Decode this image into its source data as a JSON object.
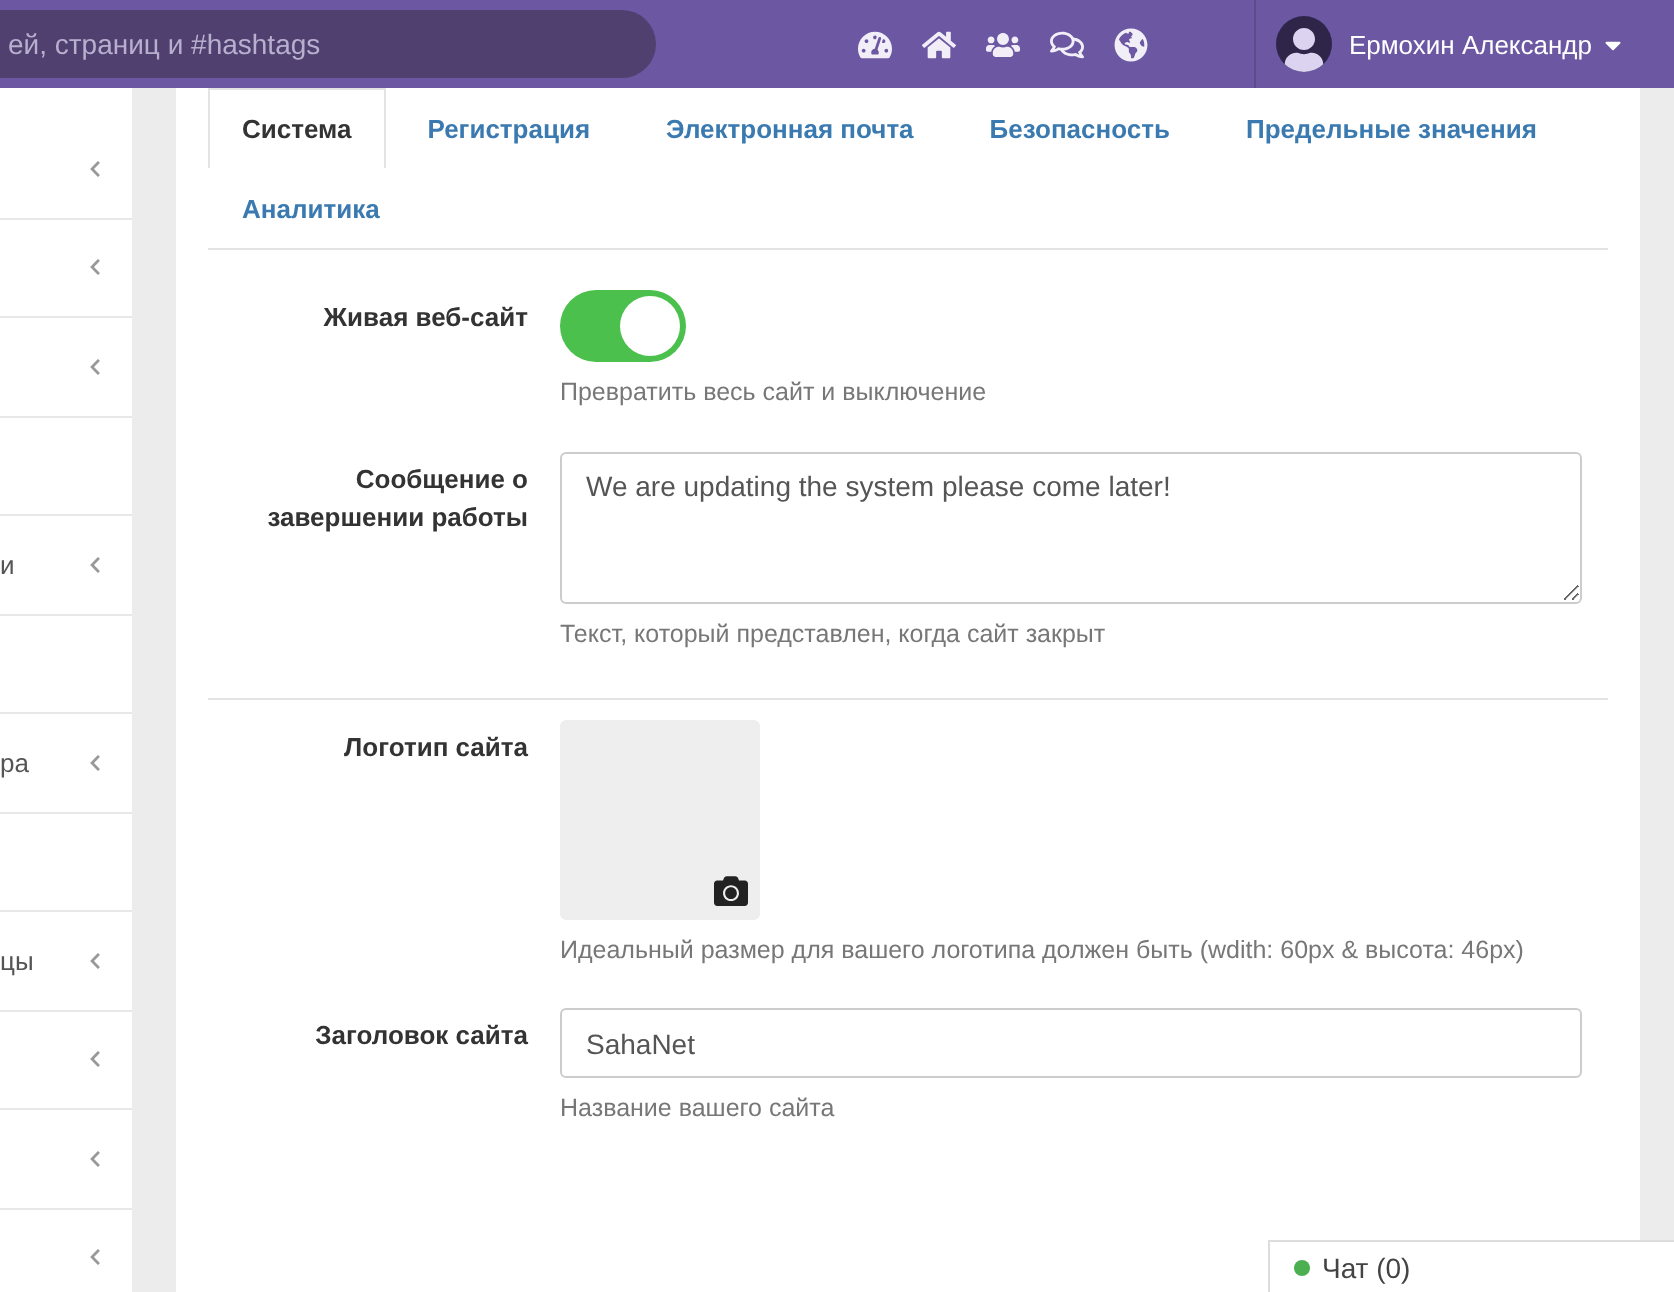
{
  "topbar": {
    "search": {
      "placeholder": "ей, страниц и #hashtags"
    },
    "user": {
      "name": "Ермохин Александр"
    }
  },
  "sidebar": {
    "items": [
      {
        "expandable": true
      },
      {
        "expandable": true
      },
      {
        "expandable": true
      },
      {
        "expandable": false
      },
      {
        "text": "и",
        "expandable": true
      },
      {
        "expandable": false
      },
      {
        "text": "ра",
        "expandable": true
      },
      {
        "expandable": false
      },
      {
        "text": "цы",
        "expandable": true
      },
      {
        "expandable": true
      },
      {
        "expandable": true
      },
      {
        "expandable": true
      }
    ]
  },
  "tabs": [
    {
      "label": "Система",
      "selected": true
    },
    {
      "label": "Регистрация",
      "selected": false
    },
    {
      "label": "Электронная почта",
      "selected": false
    },
    {
      "label": "Безопасность",
      "selected": false
    },
    {
      "label": "Предельные значения",
      "selected": false
    },
    {
      "label": "Аналитика",
      "selected": false
    }
  ],
  "form": {
    "fields": [
      {
        "kind": "toggle",
        "label": "Живая веб-сайт",
        "on": true,
        "help": "Превратить весь сайт и выключение"
      },
      {
        "kind": "textarea",
        "label": "Сообщение о завершении работы",
        "value": "We are updating the system please come later!",
        "help": "Текст, который представлен, когда сайт закрыт",
        "divider": true
      },
      {
        "kind": "image",
        "label": "Логотип сайта",
        "help": "Идеальный размер для вашего логотипа должен быть (wdith: 60px & высота: 46px)"
      },
      {
        "kind": "text",
        "label": "Заголовок сайта",
        "value": "SahaNet",
        "help": "Название вашего сайта"
      }
    ]
  },
  "chat": {
    "label": "Чат (0)",
    "color": "#4caf50"
  }
}
